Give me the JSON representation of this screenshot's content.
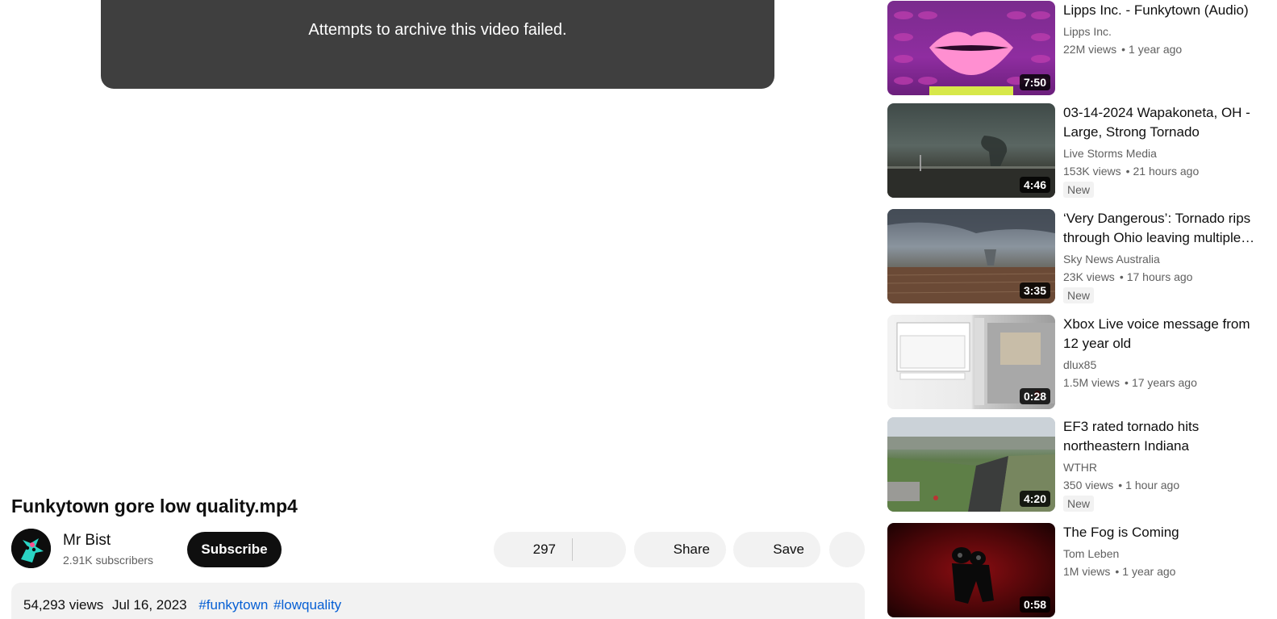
{
  "player": {
    "message": "Attempts to archive this video failed."
  },
  "video": {
    "title": "Funkytown gore low quality.mp4",
    "channel": {
      "name": "Mr Bist",
      "subscribers": "2.91K subscribers",
      "subscribe_label": "Subscribe"
    },
    "actions": {
      "like_count": "297",
      "share_label": "Share",
      "save_label": "Save"
    },
    "description": {
      "views": "54,293 views",
      "date": "Jul 16, 2023",
      "hashtags": [
        "#funkytown",
        "#lowquality"
      ]
    }
  },
  "recommendations": [
    {
      "title": "Lipps Inc. - Funkytown (Audio)",
      "channel": "Lipps Inc.",
      "views": "22M views",
      "age": "1 year ago",
      "duration": "7:50",
      "badge": "",
      "thumbnail_icon": "lips-thumbnail"
    },
    {
      "title": "03-14-2024 Wapakoneta, OH - Large, Strong Tornado",
      "channel": "Live Storms Media",
      "views": "153K views",
      "age": "21 hours ago",
      "duration": "4:46",
      "badge": "New",
      "thumbnail_icon": "tornado-thumbnail"
    },
    {
      "title": "‘Very Dangerous’: Tornado rips through Ohio leaving multiple…",
      "channel": "Sky News Australia",
      "views": "23K views",
      "age": "17 hours ago",
      "duration": "3:35",
      "badge": "New",
      "thumbnail_icon": "storm-field-thumbnail"
    },
    {
      "title": "Xbox Live voice message from 12 year old",
      "channel": "dlux85",
      "views": "1.5M views",
      "age": "17 years ago",
      "duration": "0:28",
      "badge": "",
      "thumbnail_icon": "xbox-dashboard-thumbnail"
    },
    {
      "title": "EF3 rated tornado hits northeastern Indiana",
      "channel": "WTHR",
      "views": "350 views",
      "age": "1 hour ago",
      "duration": "4:20",
      "badge": "New",
      "thumbnail_icon": "aerial-damage-thumbnail"
    },
    {
      "title": "The Fog is Coming",
      "channel": "Tom Leben",
      "views": "1M views",
      "age": "1 year ago",
      "duration": "0:58",
      "badge": "",
      "thumbnail_icon": "fog-thumbnail"
    }
  ],
  "colors": {
    "player_bg": "#3f3f3f",
    "pill_bg": "#f2f2f2",
    "subscribe_bg": "#0f0f0f",
    "hashtag": "#065fd4",
    "muted_text": "#606060"
  }
}
